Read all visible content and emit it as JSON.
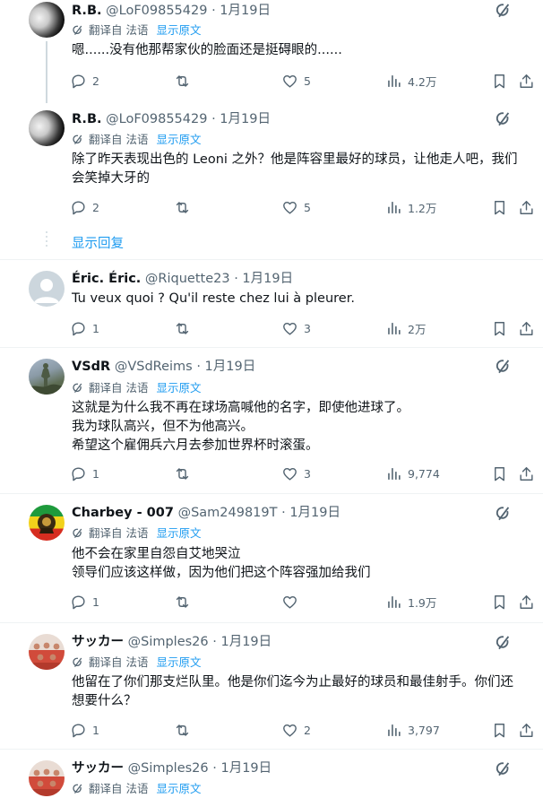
{
  "ui": {
    "show_replies": "显示回复"
  },
  "tweets": [
    {
      "name": "R.B.",
      "handle": "@LoF09855429",
      "dot": "·",
      "date": "1月19日",
      "translation": {
        "label": "翻译自 法语",
        "show_original": "显示原文"
      },
      "lines": [
        "嗯......没有他那帮家伙的脸面还是挺碍眼的......"
      ],
      "stats": {
        "replies": "2",
        "retweets": "",
        "likes": "5",
        "views": "4.2万"
      },
      "avatar": "moon-avatar"
    },
    {
      "name": "R.B.",
      "handle": "@LoF09855429",
      "dot": "·",
      "date": "1月19日",
      "translation": {
        "label": "翻译自 法语",
        "show_original": "显示原文"
      },
      "lines": [
        "除了昨天表现出色的 Leoni 之外？他是阵容里最好的球员，让他走人吧，我们",
        "会笑掉大牙的"
      ],
      "stats": {
        "replies": "2",
        "retweets": "",
        "likes": "5",
        "views": "1.2万"
      },
      "avatar": "moon-avatar"
    },
    {
      "name": "Éric. Éric.",
      "handle": "@Riquette23",
      "dot": "·",
      "date": "1月19日",
      "lines": [
        "Tu veux quoi ? Qu'il reste chez lui à pleurer."
      ],
      "stats": {
        "replies": "1",
        "retweets": "",
        "likes": "3",
        "views": "2万"
      },
      "avatar": "default-avatar"
    },
    {
      "name": "VSdR",
      "handle": "@VSdReims",
      "dot": "·",
      "date": "1月19日",
      "translation": {
        "label": "翻译自 法语",
        "show_original": "显示原文"
      },
      "lines": [
        "这就是为什么我不再在球场高喊他的名字，即使他进球了。",
        "我为球队高兴，但不为他高兴。",
        "希望这个雇佣兵六月去参加世界杯时滚蛋。"
      ],
      "stats": {
        "replies": "1",
        "retweets": "",
        "likes": "3",
        "views": "9,774"
      },
      "avatar": "statue-avatar"
    },
    {
      "name": "Charbey - 007",
      "handle": "@Sam249819T",
      "dot": "·",
      "date": "1月19日",
      "translation": {
        "label": "翻译自 法语",
        "show_original": "显示原文"
      },
      "lines": [
        "他不会在家里自怨自艾地哭泣",
        "领导们应该这样做，因为他们把这个阵容强加给我们"
      ],
      "stats": {
        "replies": "1",
        "retweets": "",
        "likes": "",
        "views": "1.9万"
      },
      "avatar": "lion-flag-avatar"
    },
    {
      "name": "サッカー",
      "handle": "@Simples26",
      "dot": "·",
      "date": "1月19日",
      "translation": {
        "label": "翻译自 法语",
        "show_original": "显示原文"
      },
      "lines": [
        "他留在了你们那支烂队里。他是你们迄今为止最好的球员和最佳射手。你们还",
        "想要什么？"
      ],
      "stats": {
        "replies": "1",
        "retweets": "",
        "likes": "2",
        "views": "3,797"
      },
      "avatar": "team-photo-avatar"
    },
    {
      "name": "サッカー",
      "handle": "@Simples26",
      "dot": "·",
      "date": "1月19日",
      "translation": {
        "label": "翻译自 法语",
        "show_original": "显示原文"
      },
      "lines": [],
      "stats": {},
      "avatar": "team-photo-avatar"
    }
  ]
}
